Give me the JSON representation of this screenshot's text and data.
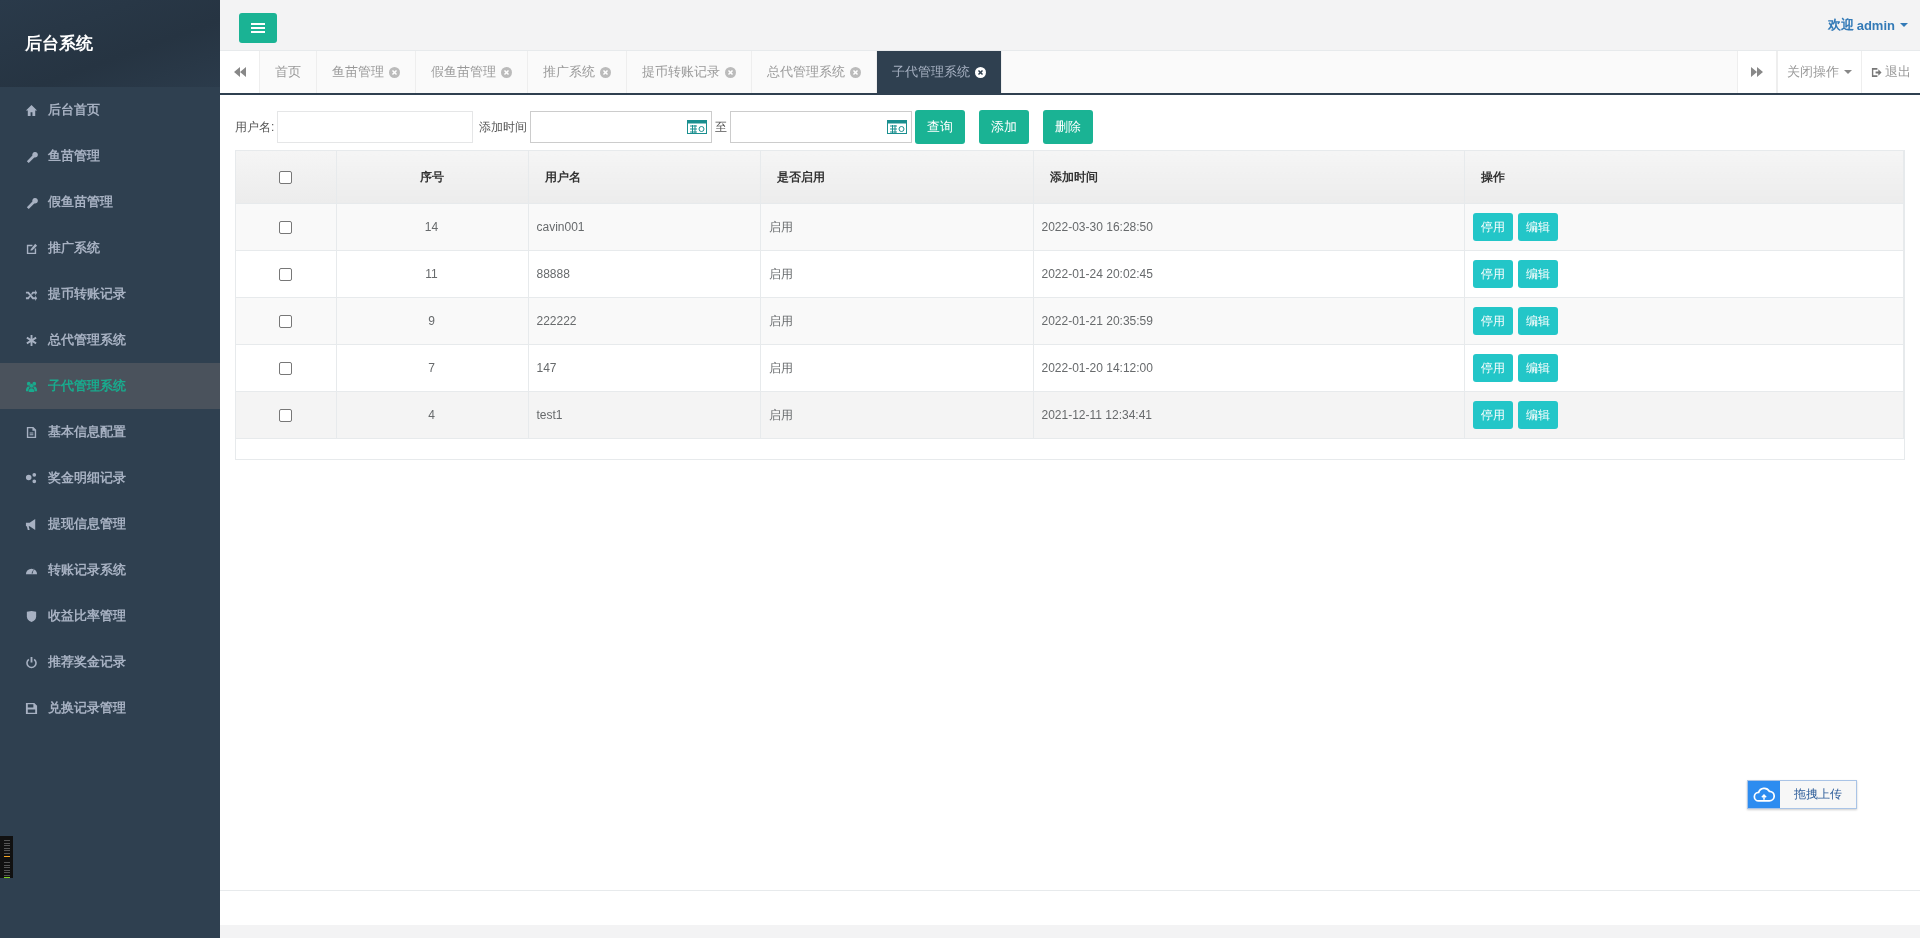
{
  "sidebar": {
    "title": "后台系统",
    "items": [
      {
        "label": "后台首页",
        "selected": false
      },
      {
        "label": "鱼苗管理",
        "selected": false
      },
      {
        "label": "假鱼苗管理",
        "selected": false
      },
      {
        "label": "推广系统",
        "selected": false
      },
      {
        "label": "提币转账记录",
        "selected": false
      },
      {
        "label": "总代管理系统",
        "selected": false
      },
      {
        "label": "子代管理系统",
        "selected": true
      },
      {
        "label": "基本信息配置",
        "selected": false
      },
      {
        "label": "奖金明细记录",
        "selected": false
      },
      {
        "label": "提现信息管理",
        "selected": false
      },
      {
        "label": "转账记录系统",
        "selected": false
      },
      {
        "label": "收益比率管理",
        "selected": false
      },
      {
        "label": "推荐奖金记录",
        "selected": false
      },
      {
        "label": "兑换记录管理",
        "selected": false
      }
    ]
  },
  "topbar": {
    "welcome": "欢迎",
    "user": "admin"
  },
  "tabs": [
    {
      "label": "首页",
      "closable": false,
      "selected": false
    },
    {
      "label": "鱼苗管理",
      "closable": true,
      "selected": false
    },
    {
      "label": "假鱼苗管理",
      "closable": true,
      "selected": false
    },
    {
      "label": "推广系统",
      "closable": true,
      "selected": false
    },
    {
      "label": "提币转账记录",
      "closable": true,
      "selected": false
    },
    {
      "label": "总代管理系统",
      "closable": true,
      "selected": false
    },
    {
      "label": "子代管理系统",
      "closable": true,
      "selected": true
    }
  ],
  "tab_actions": {
    "close_menu": "关闭操作",
    "logout": "退出"
  },
  "filters": {
    "username_label": "用户名:",
    "time_label": "添加时间",
    "to_label": "至",
    "buttons": [
      "查询",
      "添加",
      "删除"
    ]
  },
  "table": {
    "header_checked": false,
    "columns": [
      "序号",
      "用户名",
      "是否启用",
      "添加时间",
      "操作"
    ],
    "rows": [
      {
        "checked": false,
        "id": "14",
        "username": "cavin001",
        "status": "启用",
        "added": "2022-03-30 16:28:50",
        "actions": [
          "停用",
          "编辑"
        ]
      },
      {
        "checked": false,
        "id": "11",
        "username": "88888",
        "status": "启用",
        "added": "2022-01-24 20:02:45",
        "actions": [
          "停用",
          "编辑"
        ]
      },
      {
        "checked": false,
        "id": "9",
        "username": "222222",
        "status": "启用",
        "added": "2022-01-21 20:35:59",
        "actions": [
          "停用",
          "编辑"
        ]
      },
      {
        "checked": false,
        "id": "7",
        "username": "147",
        "status": "启用",
        "added": "2022-01-20 14:12:00",
        "actions": [
          "停用",
          "编辑"
        ]
      },
      {
        "checked": false,
        "id": "4",
        "username": "test1",
        "status": "启用",
        "added": "2021-12-11 12:34:41",
        "actions": [
          "停用",
          "编辑"
        ]
      }
    ]
  },
  "upload": {
    "label": "拖拽上传"
  }
}
